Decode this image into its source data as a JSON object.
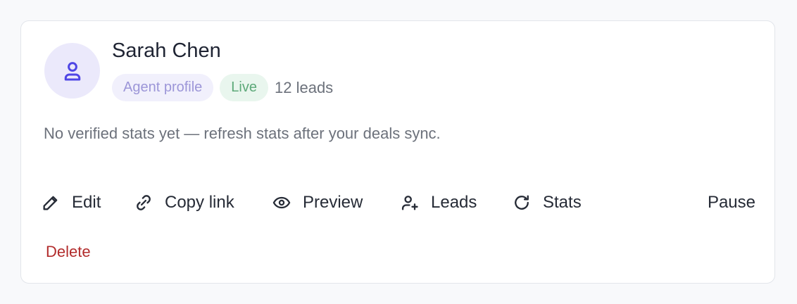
{
  "profile": {
    "name": "Sarah Chen",
    "avatar_icon": "user-icon",
    "badge_type": "Agent profile",
    "badge_status": "Live",
    "leads_count": "12 leads",
    "description": "No verified stats yet — refresh stats after your deals sync."
  },
  "actions": {
    "edit": {
      "label": "Edit",
      "icon": "pencil-icon"
    },
    "copy_link": {
      "label": "Copy link",
      "icon": "link-icon"
    },
    "preview": {
      "label": "Preview",
      "icon": "eye-icon"
    },
    "leads": {
      "label": "Leads",
      "icon": "user-plus-icon"
    },
    "stats": {
      "label": "Stats",
      "icon": "refresh-icon"
    },
    "pause": {
      "label": "Pause"
    },
    "delete": {
      "label": "Delete"
    }
  },
  "colors": {
    "accent": "#4f46e5",
    "badge_type_bg": "#f1f0fc",
    "badge_type_text": "#9c96d8",
    "badge_status_bg": "#e9f6ee",
    "badge_status_text": "#5da979",
    "danger": "#b22c2c"
  }
}
